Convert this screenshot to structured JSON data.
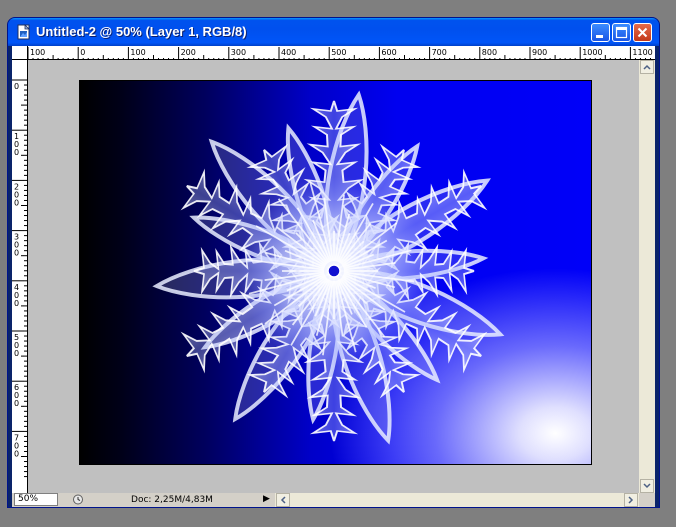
{
  "window": {
    "title": "Untitled-2 @ 50% (Layer 1, RGB/8)"
  },
  "rulers": {
    "horizontal_labels": [
      "100",
      "0",
      "100",
      "200",
      "300",
      "400",
      "500",
      "600",
      "700",
      "800",
      "900",
      "1000",
      "1100"
    ],
    "vertical_labels": [
      "0",
      "100",
      "200",
      "300",
      "400",
      "500",
      "600",
      "700"
    ]
  },
  "status_bar": {
    "zoom": "50%",
    "doc_info": "Doc: 2,25M/4,83M",
    "menu_arrow": "▶"
  },
  "colors": {
    "title_bar": "#0054e3",
    "close_button": "#d44a2a",
    "canvas_background": "#c0c0c0",
    "image_gradient_dark": "#000000",
    "image_gradient_blue": "#0000f8",
    "image_highlight": "#ffffff"
  },
  "icons": {
    "app": "photoshop-document-icon",
    "minimize": "minimize-icon",
    "maximize": "maximize-icon",
    "close": "close-icon",
    "status_menu": "clock-icon"
  }
}
